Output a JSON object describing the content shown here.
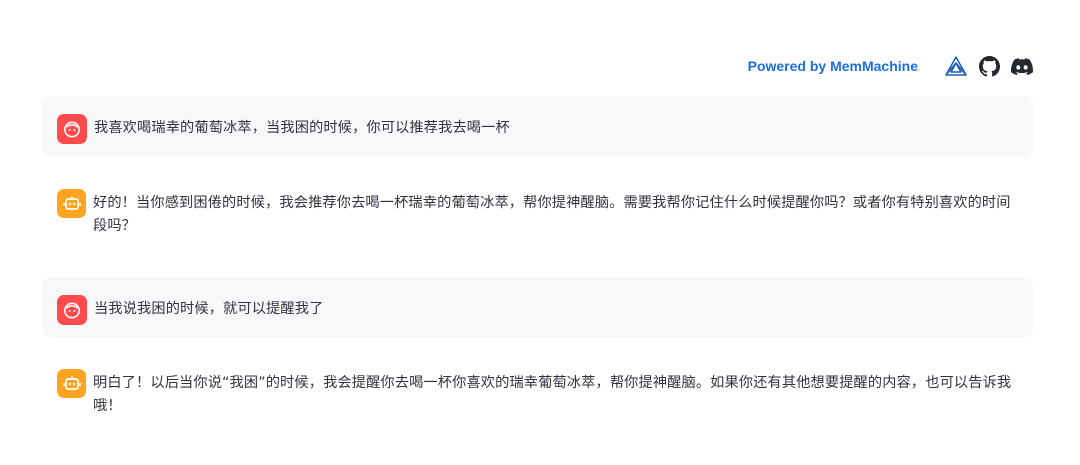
{
  "header": {
    "powered_by": "Powered by MemMachine",
    "icons": [
      "memmachine-logo-icon",
      "github-icon",
      "discord-icon"
    ]
  },
  "colors": {
    "accent": "#1c6fe0",
    "user_avatar": "#ff4b4b",
    "assistant_avatar": "#ffa421",
    "user_bubble": "#f7f8fa"
  },
  "messages": [
    {
      "role": "user",
      "avatar_icon": "user-face-icon",
      "text": "我喜欢喝瑞幸的葡萄冰萃，当我困的时候，你可以推荐我去喝一杯"
    },
    {
      "role": "assistant",
      "avatar_icon": "robot-icon",
      "text": "好的！当你感到困倦的时候，我会推荐你去喝一杯瑞幸的葡萄冰萃，帮你提神醒脑。需要我帮你记住什么时候提醒你吗？或者你有特别喜欢的时间段吗？"
    },
    {
      "role": "user",
      "avatar_icon": "user-face-icon",
      "text": "当我说我困的时候，就可以提醒我了"
    },
    {
      "role": "assistant",
      "avatar_icon": "robot-icon",
      "text": "明白了！以后当你说“我困”的时候，我会提醒你去喝一杯你喜欢的瑞幸葡萄冰萃，帮你提神醒脑。如果你还有其他想要提醒的内容，也可以告诉我哦！"
    }
  ]
}
